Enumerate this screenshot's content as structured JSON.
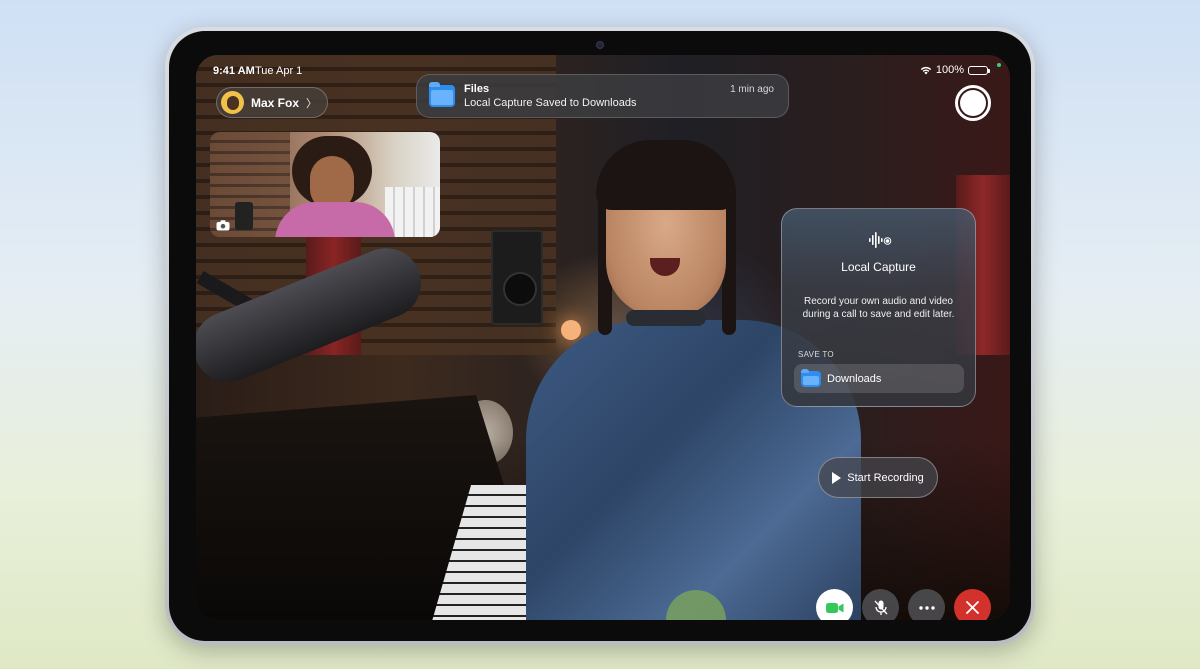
{
  "status_bar": {
    "time": "9:41 AM",
    "date": "Tue Apr 1",
    "battery": "100%",
    "battery_level": 1.0
  },
  "caller": {
    "name": "Max Fox",
    "chevron": "〉"
  },
  "notification": {
    "app": "Files",
    "message": "Local Capture Saved to Downloads",
    "time": "1 min ago",
    "icon": "folder-icon"
  },
  "local_capture": {
    "title": "Local Capture",
    "description": "Record your own audio and video during a call to save and edit later.",
    "save_to_label": "SAVE TO",
    "destination": "Downloads",
    "icon": "waveform-icon"
  },
  "start_recording": {
    "label": "Start Recording"
  },
  "controls": {
    "video_icon": "video-camera-icon",
    "mic_icon": "microphone-slash-icon",
    "more_icon": "ellipsis-icon",
    "end_icon": "close-icon",
    "end_color": "#d3312c",
    "video_color": "#34c759"
  }
}
